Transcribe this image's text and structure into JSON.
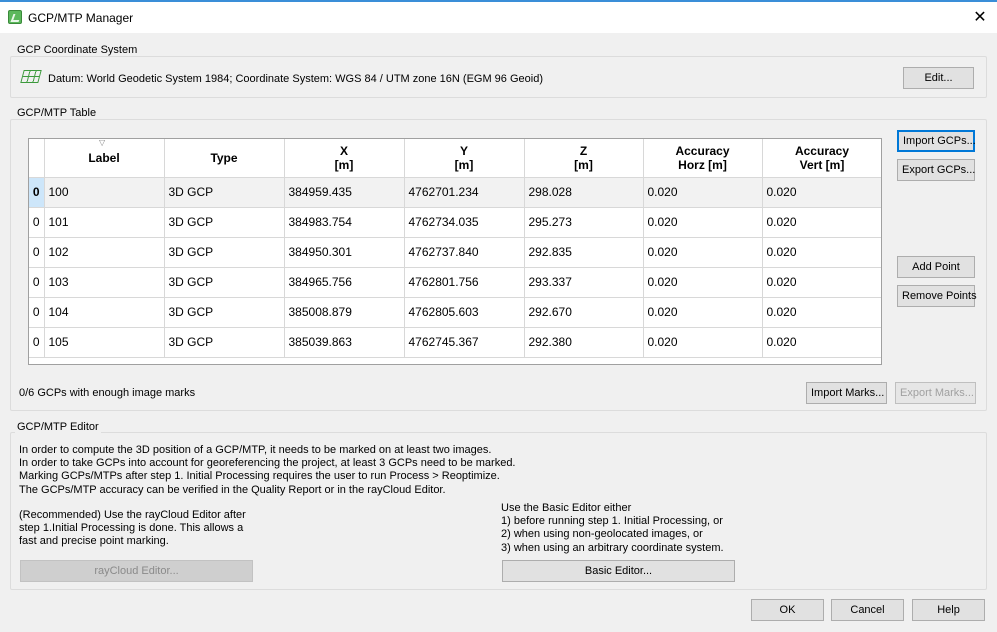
{
  "window": {
    "title": "GCP/MTP Manager",
    "close": "✕"
  },
  "coord_system": {
    "group_title": "GCP Coordinate System",
    "description": "Datum: World Geodetic System 1984; Coordinate System: WGS 84 / UTM zone 16N (EGM 96 Geoid)",
    "edit_label": "Edit..."
  },
  "table_group": {
    "title": "GCP/MTP Table",
    "columns": [
      {
        "line1": "Label",
        "line2": ""
      },
      {
        "line1": "Type",
        "line2": ""
      },
      {
        "line1": "X",
        "line2": "[m]"
      },
      {
        "line1": "Y",
        "line2": "[m]"
      },
      {
        "line1": "Z",
        "line2": "[m]"
      },
      {
        "line1": "Accuracy",
        "line2": "Horz [m]"
      },
      {
        "line1": "Accuracy",
        "line2": "Vert [m]"
      }
    ],
    "rows": [
      {
        "idx": "0",
        "label": "100",
        "type": "3D GCP",
        "x": "384959.435",
        "y": "4762701.234",
        "z": "298.028",
        "acc_h": "0.020",
        "acc_v": "0.020"
      },
      {
        "idx": "0",
        "label": "101",
        "type": "3D GCP",
        "x": "384983.754",
        "y": "4762734.035",
        "z": "295.273",
        "acc_h": "0.020",
        "acc_v": "0.020"
      },
      {
        "idx": "0",
        "label": "102",
        "type": "3D GCP",
        "x": "384950.301",
        "y": "4762737.840",
        "z": "292.835",
        "acc_h": "0.020",
        "acc_v": "0.020"
      },
      {
        "idx": "0",
        "label": "103",
        "type": "3D GCP",
        "x": "384965.756",
        "y": "4762801.756",
        "z": "293.337",
        "acc_h": "0.020",
        "acc_v": "0.020"
      },
      {
        "idx": "0",
        "label": "104",
        "type": "3D GCP",
        "x": "385008.879",
        "y": "4762805.603",
        "z": "292.670",
        "acc_h": "0.020",
        "acc_v": "0.020"
      },
      {
        "idx": "0",
        "label": "105",
        "type": "3D GCP",
        "x": "385039.863",
        "y": "4762745.367",
        "z": "292.380",
        "acc_h": "0.020",
        "acc_v": "0.020"
      }
    ],
    "import_gcps": "Import GCPs...",
    "export_gcps": "Export GCPs...",
    "add_point": "Add Point",
    "remove_points": "Remove Points",
    "status": "0/6 GCPs with enough image marks",
    "import_marks": "Import Marks...",
    "export_marks": "Export Marks..."
  },
  "editor": {
    "title": "GCP/MTP Editor",
    "info": [
      "In order to compute the 3D position of a GCP/MTP, it needs to be marked on at least two images.",
      "In order to take GCPs into account for georeferencing the project, at least 3 GCPs need to be marked.",
      "Marking GCPs/MTPs after step 1. Initial Processing requires the user to run Process > Reoptimize.",
      "The GCPs/MTP accuracy can be verified in the Quality Report or in the rayCloud Editor."
    ],
    "left_text": [
      "(Recommended) Use the rayCloud Editor after",
      "step 1.Initial Processing is done. This allows a",
      "fast and precise point marking."
    ],
    "right_text": [
      "Use the Basic Editor either",
      "1) before running step 1. Initial Processing, or",
      "2) when using non-geolocated images, or",
      "3) when using an arbitrary coordinate system."
    ],
    "raycloud_button": "rayCloud Editor...",
    "basic_button": "Basic Editor..."
  },
  "footer": {
    "ok": "OK",
    "cancel": "Cancel",
    "help": "Help"
  },
  "icons": {
    "app": "app-icon",
    "coord": "grid-icon"
  },
  "colors": {
    "accent": "#0078d7",
    "selected_row_header": "#cde6fa"
  }
}
